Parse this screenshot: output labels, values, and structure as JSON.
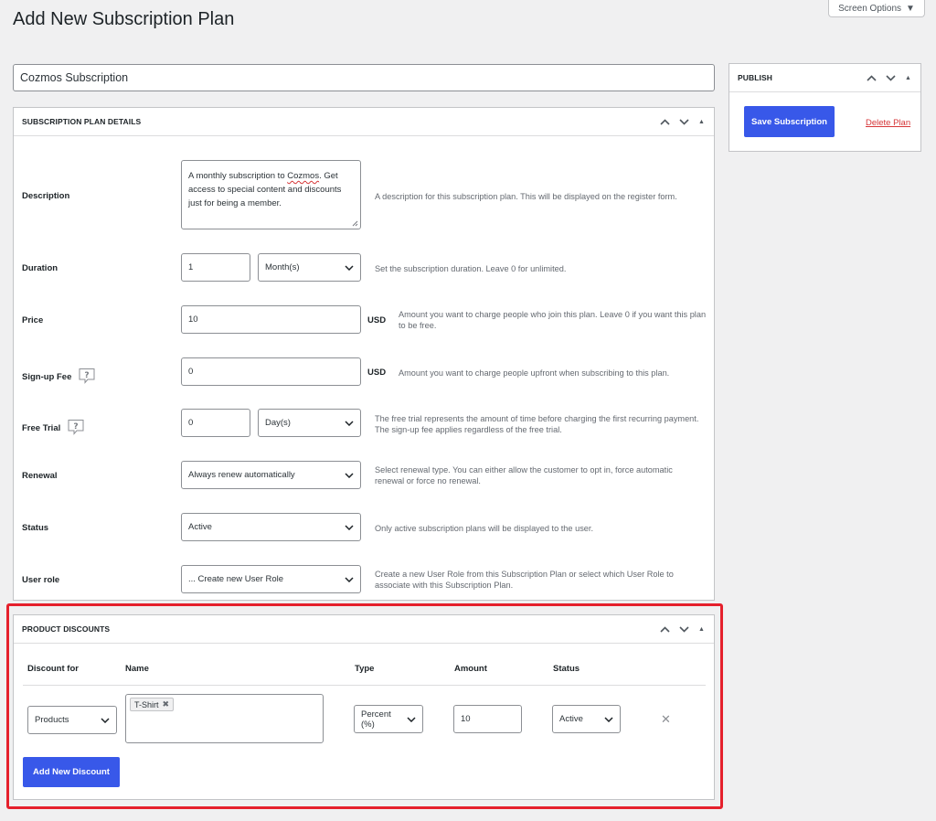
{
  "page": {
    "title": "Add New Subscription Plan",
    "screen_options": "Screen Options"
  },
  "plan_title": {
    "value": "Cozmos Subscription"
  },
  "details": {
    "heading": "SUBSCRIPTION PLAN DETAILS",
    "description": {
      "label": "Description",
      "value_before": "A monthly subscription to ",
      "value_spell": "Cozmos",
      "value_after": ". Get access to special content and discounts just for being a member.",
      "help": "A description for this subscription plan. This will be displayed on the register form."
    },
    "duration": {
      "label": "Duration",
      "value": "1",
      "unit": "Month(s)",
      "help": "Set the subscription duration. Leave 0 for unlimited."
    },
    "price": {
      "label": "Price",
      "value": "10",
      "currency": "USD",
      "help": "Amount you want to charge people who join this plan. Leave 0 if you want this plan to be free."
    },
    "signup_fee": {
      "label": "Sign-up Fee",
      "value": "0",
      "currency": "USD",
      "help": "Amount you want to charge people upfront when subscribing to this plan."
    },
    "free_trial": {
      "label": "Free Trial",
      "value": "0",
      "unit": "Day(s)",
      "help": "The free trial represents the amount of time before charging the first recurring payment. The sign-up fee applies regardless of the free trial."
    },
    "renewal": {
      "label": "Renewal",
      "value": "Always renew automatically",
      "help": "Select renewal type. You can either allow the customer to opt in, force automatic renewal or force no renewal."
    },
    "status": {
      "label": "Status",
      "value": "Active",
      "help": "Only active subscription plans will be displayed to the user."
    },
    "user_role": {
      "label": "User role",
      "value": "... Create new User Role",
      "help": "Create a new User Role from this Subscription Plan or select which User Role to associate with this Subscription Plan."
    }
  },
  "publish": {
    "heading": "PUBLISH",
    "save_label": "Save Subscription",
    "delete_label": "Delete Plan"
  },
  "discounts": {
    "heading": "PRODUCT DISCOUNTS",
    "columns": [
      "Discount for",
      "Name",
      "Type",
      "Amount",
      "Status"
    ],
    "rows": [
      {
        "discount_for": "Products",
        "names": [
          "T-Shirt"
        ],
        "type": "Percent (%)",
        "amount": "10",
        "status": "Active"
      }
    ],
    "add_label": "Add New Discount"
  },
  "icons": {
    "move_up": "chevron-up-icon",
    "move_down": "chevron-down-icon",
    "toggle": "triangle-up-icon",
    "tooltip": "help-tooltip-icon",
    "remove": "close-icon"
  },
  "colors": {
    "primary": "#3858e9",
    "danger": "#d63638",
    "highlight": "#e5202c"
  }
}
